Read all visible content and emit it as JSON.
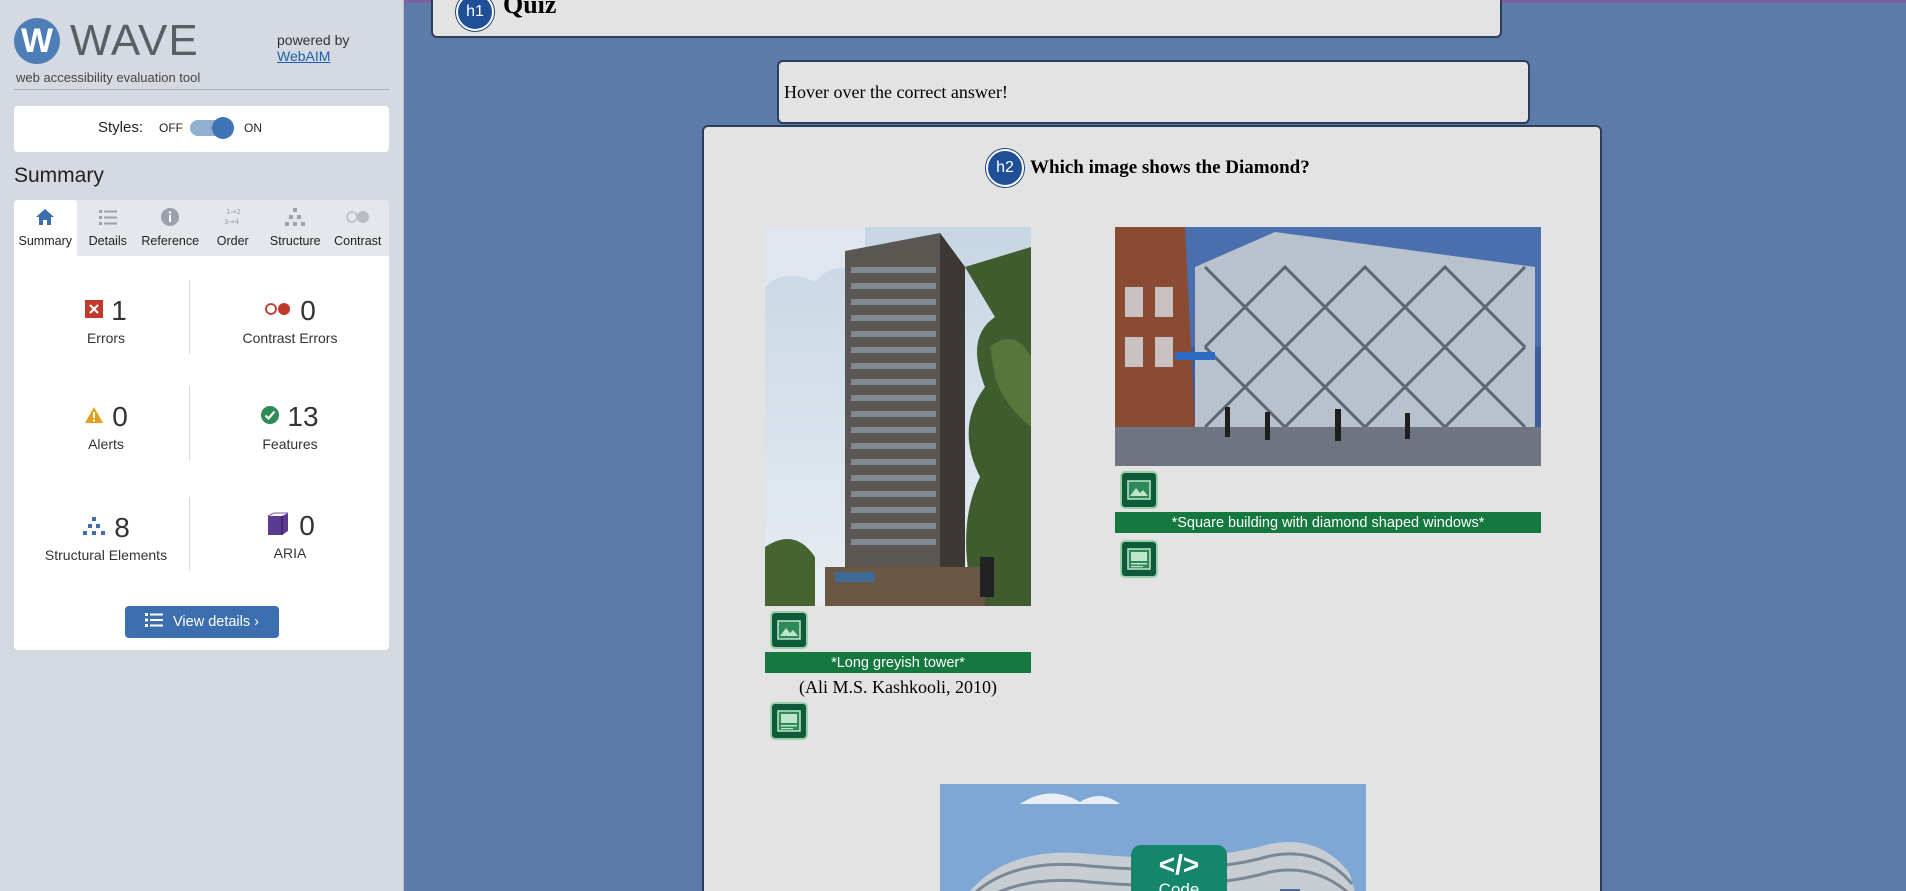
{
  "wave": {
    "logo_mark": "W",
    "logo_text": "WAVE",
    "subtitle": "web accessibility evaluation tool",
    "powered_by": "powered by",
    "webaim_link": "WebAIM"
  },
  "styles": {
    "label": "Styles:",
    "off": "OFF",
    "on": "ON",
    "state": "on"
  },
  "summary_title": "Summary",
  "tabs": [
    {
      "label": "Summary",
      "icon": "home-icon",
      "active": true
    },
    {
      "label": "Details",
      "icon": "list-icon",
      "active": false
    },
    {
      "label": "Reference",
      "icon": "info-icon",
      "active": false
    },
    {
      "label": "Order",
      "icon": "order-icon",
      "active": false
    },
    {
      "label": "Structure",
      "icon": "structure-icon",
      "active": false
    },
    {
      "label": "Contrast",
      "icon": "contrast-icon",
      "active": false
    }
  ],
  "stats": {
    "errors": {
      "value": "1",
      "label": "Errors",
      "icon": "error-icon",
      "color": "#c0392b"
    },
    "contrast_errors": {
      "value": "0",
      "label": "Contrast Errors",
      "icon": "contrast-error-icon",
      "color": "#c0392b"
    },
    "alerts": {
      "value": "0",
      "label": "Alerts",
      "icon": "alert-icon",
      "color": "#e3a019"
    },
    "features": {
      "value": "13",
      "label": "Features",
      "icon": "feature-icon",
      "color": "#2e8b57"
    },
    "structural": {
      "value": "8",
      "label": "Structural Elements",
      "icon": "structure-icon",
      "color": "#3d6fb0"
    },
    "aria": {
      "value": "0",
      "label": "ARIA",
      "icon": "aria-icon",
      "color": "#5b3b8f"
    }
  },
  "view_details": "View details ›",
  "page": {
    "h1_badge": "h1",
    "h1_title": "Quiz",
    "hover_text": "Hover over the correct answer!",
    "h2_badge": "h2",
    "h2_title": "Which image shows the Diamond?",
    "image1_alt": "*Long greyish tower*",
    "image1_credit": "(Ali M.S. Kashkooli, 2010)",
    "image2_alt": "*Square building with diamond shaped windows*",
    "code_symbol": "</>",
    "code_label": "Code"
  },
  "colors": {
    "main_bg": "#5c7ba8",
    "sidebar_bg": "#d4d9e2",
    "accent": "#3d6fb0",
    "alt_bar": "#14783f"
  }
}
